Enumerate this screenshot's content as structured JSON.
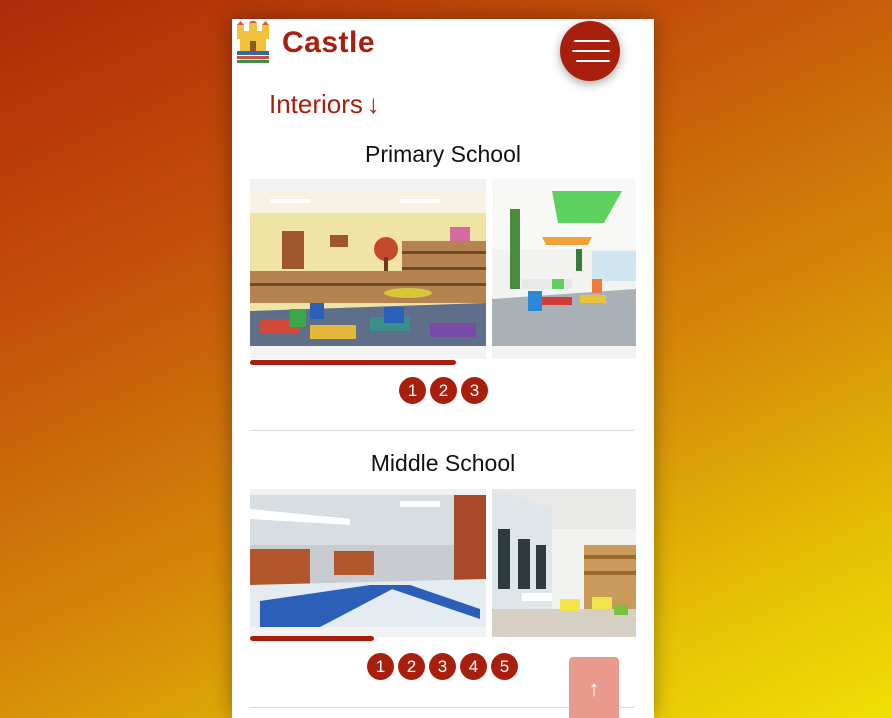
{
  "header": {
    "brand": "Castle",
    "logo_icon": "castle-logo-icon",
    "menu_icon": "hamburger-menu-icon"
  },
  "section_link": {
    "label": "Interiors",
    "arrow": "↓"
  },
  "groups": [
    {
      "title": "Primary School",
      "slides": [
        "library-classroom-photo",
        "cafeteria-classroom-photo"
      ],
      "progress_fraction": 0.55,
      "pages": [
        "1",
        "2",
        "3"
      ]
    },
    {
      "title": "Middle School",
      "slides": [
        "hallway-lockers-photo",
        "dining-area-photo"
      ],
      "progress_fraction": 0.33,
      "pages": [
        "1",
        "2",
        "3",
        "4",
        "5"
      ]
    }
  ],
  "scroll_top": {
    "arrow": "↑"
  },
  "colors": {
    "accent": "#a8200d",
    "scroll_top_bg": "#e99a8c",
    "background_start": "#b02a08",
    "background_end": "#f0de05"
  }
}
